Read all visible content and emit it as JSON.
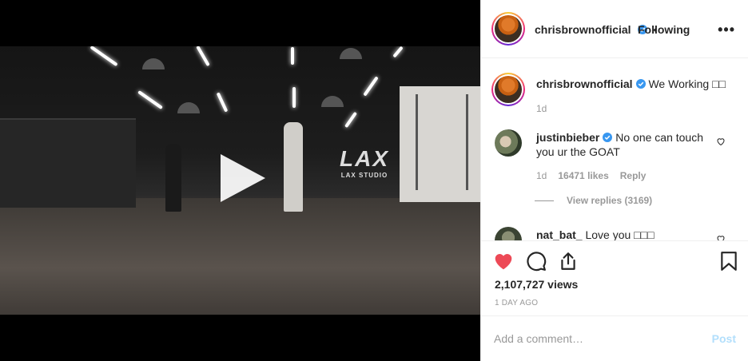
{
  "video": {
    "studio_logo": "LAX",
    "studio_name": "LAX STUDIO"
  },
  "header": {
    "username": "chrisbrownofficial",
    "separator": "•",
    "follow_status": "Following",
    "more": "•••"
  },
  "caption": {
    "username": "chrisbrownofficial",
    "text": "We Working □□",
    "time": "1d"
  },
  "comments": [
    {
      "username": "justinbieber",
      "text_line1": "No one can touch",
      "text_line2": "you ur the GOAT",
      "time": "1d",
      "likes": "16471 likes",
      "reply": "Reply",
      "view_replies": "View replies (3169)"
    },
    {
      "username": "nat_bat_",
      "text": "Love you □□□"
    }
  ],
  "stats": {
    "views": "2,107,727 views",
    "time_ago": "1 DAY AGO"
  },
  "add_comment": {
    "placeholder": "Add a comment…",
    "post_label": "Post"
  },
  "colors": {
    "like_red": "#ed4956",
    "verified_blue": "#3897f0",
    "post_disabled": "#b2dffc"
  }
}
